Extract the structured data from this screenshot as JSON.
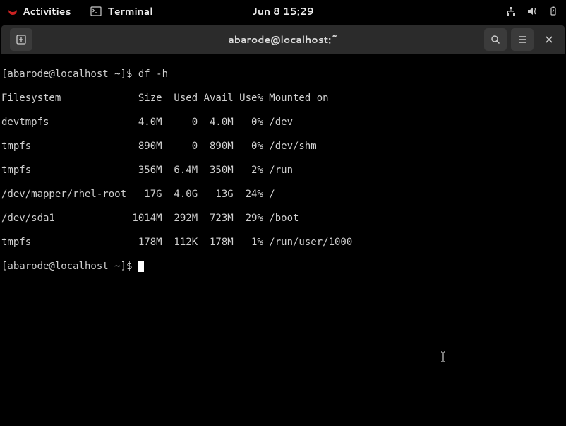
{
  "topbar": {
    "activities": "Activities",
    "app_name": "Terminal",
    "clock": "Jun 8  15:29"
  },
  "window": {
    "title": "abarode@localhost:~"
  },
  "terminal": {
    "prompt1": "[abarode@localhost ~]$ ",
    "command1": "df -h",
    "header": "Filesystem             Size  Used Avail Use% Mounted on",
    "rows": [
      "devtmpfs               4.0M     0  4.0M   0% /dev",
      "tmpfs                  890M     0  890M   0% /dev/shm",
      "tmpfs                  356M  6.4M  350M   2% /run",
      "/dev/mapper/rhel-root   17G  4.0G   13G  24% /",
      "/dev/sda1             1014M  292M  723M  29% /boot",
      "tmpfs                  178M  112K  178M   1% /run/user/1000"
    ],
    "prompt2": "[abarode@localhost ~]$ "
  },
  "df_data": [
    {
      "filesystem": "devtmpfs",
      "size": "4.0M",
      "used": "0",
      "avail": "4.0M",
      "use_pct": "0%",
      "mount": "/dev"
    },
    {
      "filesystem": "tmpfs",
      "size": "890M",
      "used": "0",
      "avail": "890M",
      "use_pct": "0%",
      "mount": "/dev/shm"
    },
    {
      "filesystem": "tmpfs",
      "size": "356M",
      "used": "6.4M",
      "avail": "350M",
      "use_pct": "2%",
      "mount": "/run"
    },
    {
      "filesystem": "/dev/mapper/rhel-root",
      "size": "17G",
      "used": "4.0G",
      "avail": "13G",
      "use_pct": "24%",
      "mount": "/"
    },
    {
      "filesystem": "/dev/sda1",
      "size": "1014M",
      "used": "292M",
      "avail": "723M",
      "use_pct": "29%",
      "mount": "/boot"
    },
    {
      "filesystem": "tmpfs",
      "size": "178M",
      "used": "112K",
      "avail": "178M",
      "use_pct": "1%",
      "mount": "/run/user/1000"
    }
  ]
}
